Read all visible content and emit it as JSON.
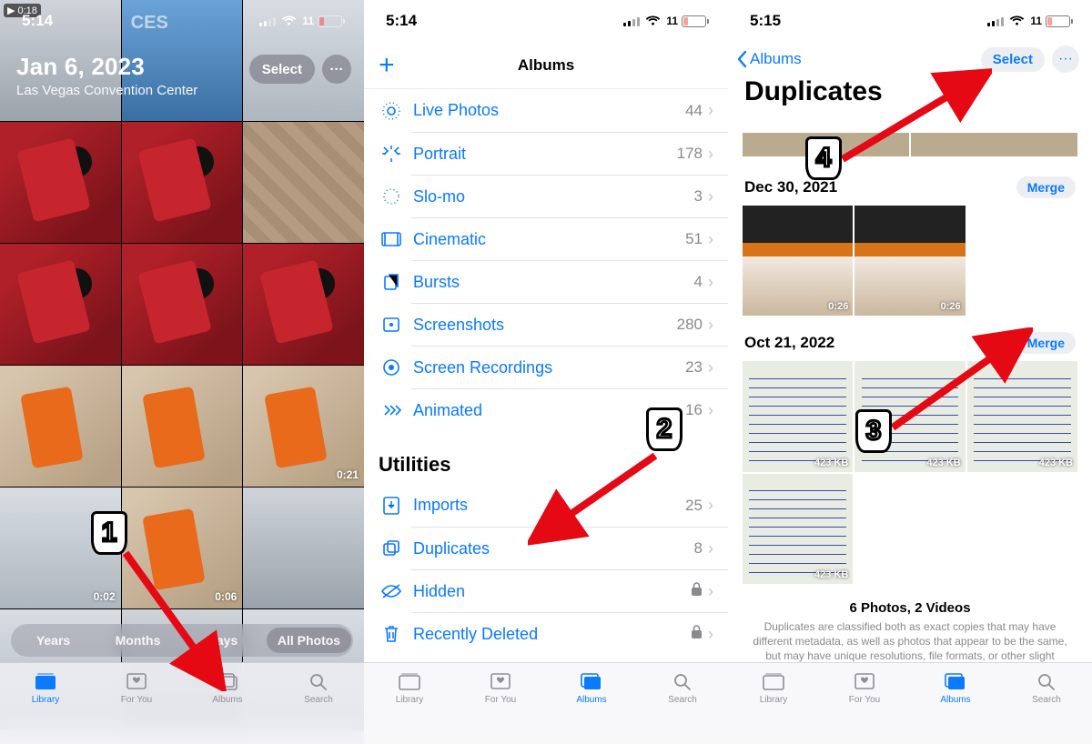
{
  "colors": {
    "accent": "#0a7aff",
    "muted": "#8e8e93",
    "battery_low": "#ff453a"
  },
  "statusbars": {
    "p1": {
      "time": "5:14",
      "battery": "11",
      "top_video_badge": "0:18"
    },
    "p2": {
      "time": "5:14",
      "battery": "11"
    },
    "p3": {
      "time": "5:15",
      "battery": "11"
    }
  },
  "p1": {
    "title": "Jan 6, 2023",
    "subtitle": "Las Vegas Convention Center",
    "select": "Select",
    "segments": [
      "Years",
      "Months",
      "Days",
      "All Photos"
    ],
    "durations": {
      "tile12": "0:21",
      "tile13": "0:02",
      "tile14": "0:06"
    }
  },
  "tabs": {
    "library": "Library",
    "foryou": "For You",
    "albums": "Albums",
    "search": "Search"
  },
  "p2": {
    "nav_title": "Albums",
    "media_types": [
      {
        "key": "live",
        "label": "Live Photos",
        "count": "44"
      },
      {
        "key": "portrait",
        "label": "Portrait",
        "count": "178"
      },
      {
        "key": "slomo",
        "label": "Slo-mo",
        "count": "3"
      },
      {
        "key": "cine",
        "label": "Cinematic",
        "count": "51"
      },
      {
        "key": "bursts",
        "label": "Bursts",
        "count": "4"
      },
      {
        "key": "screens",
        "label": "Screenshots",
        "count": "280"
      },
      {
        "key": "screc",
        "label": "Screen Recordings",
        "count": "23"
      },
      {
        "key": "anim",
        "label": "Animated",
        "count": "16"
      }
    ],
    "utilities_header": "Utilities",
    "utilities": [
      {
        "key": "imports",
        "label": "Imports",
        "count": "25",
        "locked": false
      },
      {
        "key": "dupes",
        "label": "Duplicates",
        "count": "8",
        "locked": false
      },
      {
        "key": "hidden",
        "label": "Hidden",
        "count": "",
        "locked": true
      },
      {
        "key": "deleted",
        "label": "Recently Deleted",
        "count": "",
        "locked": true
      }
    ]
  },
  "p3": {
    "back_label": "Albums",
    "select": "Select",
    "title": "Duplicates",
    "groups": [
      {
        "date": "Dec 30, 2021",
        "merge": "Merge",
        "items": [
          {
            "dur": "0:26"
          },
          {
            "dur": "0:26"
          }
        ]
      },
      {
        "date": "Oct 21, 2022",
        "merge": "Merge",
        "items": [
          {
            "kb": "423 KB"
          },
          {
            "kb": "423 KB"
          },
          {
            "kb": "423 KB"
          },
          {
            "kb": "423 KB"
          }
        ]
      }
    ],
    "footer_heading": "6 Photos, 2 Videos",
    "footer_body": "Duplicates are classified both as exact copies that may have different metadata, as well as photos that appear to be the same, but may have unique resolutions, file formats, or other slight differences."
  },
  "annotations": {
    "b1": "1",
    "b2": "2",
    "b3": "3",
    "b4": "4"
  }
}
